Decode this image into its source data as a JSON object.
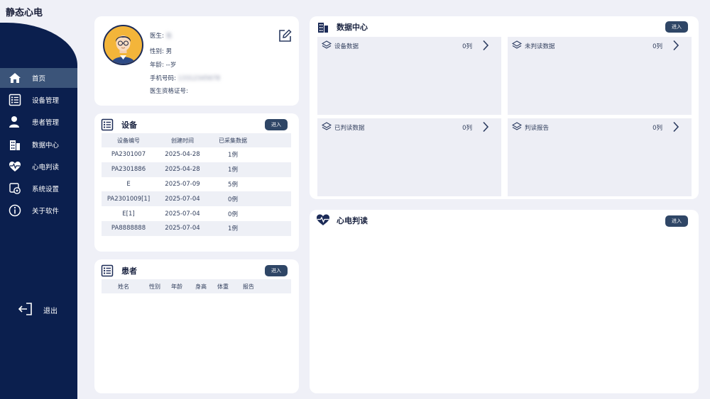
{
  "app": {
    "title": "静态心电"
  },
  "sidebar": {
    "items": [
      {
        "label": "首页",
        "icon": "home-icon",
        "active": true
      },
      {
        "label": "设备管理",
        "icon": "device-icon"
      },
      {
        "label": "患者管理",
        "icon": "patient-icon"
      },
      {
        "label": "数据中心",
        "icon": "building-icon"
      },
      {
        "label": "心电判读",
        "icon": "heart-pulse-icon"
      },
      {
        "label": "系统设置",
        "icon": "settings-icon"
      },
      {
        "label": "关于软件",
        "icon": "info-icon"
      }
    ],
    "logout": "退出"
  },
  "profile": {
    "doctor_label": "医生:",
    "doctor_value": "张",
    "gender_label": "性别:",
    "gender_value": "男",
    "age_label": "年龄:",
    "age_value": "--岁",
    "phone_label": "手机号码:",
    "phone_value": "13312345678",
    "license_label": "医生资格证号:",
    "license_value": ""
  },
  "devices": {
    "title": "设备",
    "enter": "进入",
    "columns": [
      "设备编号",
      "创建时间",
      "已采集数据"
    ],
    "rows": [
      [
        "PA2301007",
        "2025-04-28",
        "1例"
      ],
      [
        "PA2301886",
        "2025-04-28",
        "1例"
      ],
      [
        "E",
        "2025-07-09",
        "5例"
      ],
      [
        "PA2301009[1]",
        "2025-07-04",
        "0例"
      ],
      [
        "E[1]",
        "2025-07-04",
        "0例"
      ],
      [
        "PA8888888",
        "2025-07-04",
        "1例"
      ]
    ]
  },
  "patients": {
    "title": "患者",
    "enter": "进入",
    "columns": [
      "姓名",
      "性别",
      "年龄",
      "身高",
      "体重",
      "报告"
    ]
  },
  "data_center": {
    "title": "数据中心",
    "enter": "进入",
    "tiles": [
      {
        "label": "设备数据",
        "count": "0列"
      },
      {
        "label": "未判读数据",
        "count": "0列"
      },
      {
        "label": "已判读数据",
        "count": "0列"
      },
      {
        "label": "判读报告",
        "count": "0列"
      }
    ]
  },
  "ecg": {
    "title": "心电判读",
    "enter": "进入"
  },
  "colors": {
    "sidebar": "#0b1f4e",
    "active": "#3b5479",
    "button": "#2f4666",
    "background": "#eff0f7"
  }
}
